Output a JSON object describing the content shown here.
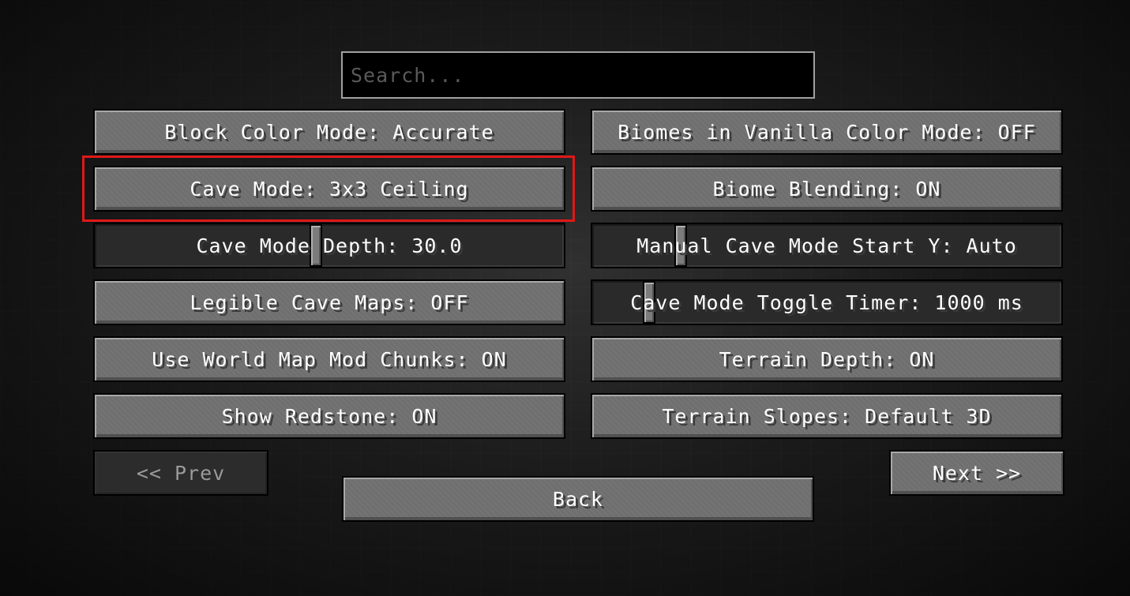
{
  "search": {
    "placeholder": "Search...",
    "value": ""
  },
  "options": {
    "block_color_mode": "Block Color Mode: Accurate",
    "biomes_vanilla": "Biomes in Vanilla Color Mode: OFF",
    "cave_mode": "Cave Mode: 3x3 Ceiling",
    "biome_blending": "Biome Blending: ON",
    "cave_mode_depth": {
      "label": "Cave Mode Depth: 30.0",
      "fraction": 0.47
    },
    "manual_cave_start": {
      "label": "Manual Cave Mode Start Y: Auto",
      "fraction": 0.18
    },
    "legible_cave_maps": "Legible Cave Maps: OFF",
    "cave_toggle_timer": {
      "label": "Cave Mode Toggle Timer: 1000 ms",
      "fraction": 0.11
    },
    "world_map_chunks": "Use World Map Mod Chunks: ON",
    "terrain_depth": "Terrain Depth: ON",
    "show_redstone": "Show Redstone: ON",
    "terrain_slopes": "Terrain Slopes: Default 3D"
  },
  "nav": {
    "prev": "<< Prev",
    "next": "Next >>",
    "back": "Back"
  },
  "colors": {
    "highlight": "#e01818",
    "button": "#6f6f6f",
    "disabled": "#2c2c2c"
  }
}
